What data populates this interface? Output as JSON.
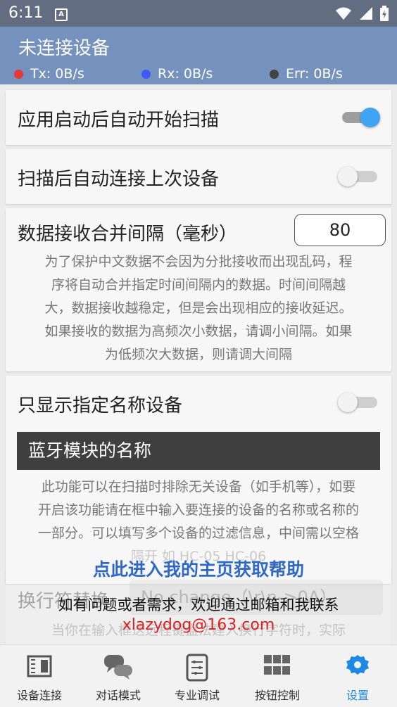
{
  "status_bar": {
    "time": "6:11",
    "notif_glyph": "A"
  },
  "header": {
    "title": "未连接设备",
    "tx": "Tx: 0B/s",
    "rx": "Rx: 0B/s",
    "err": "Err: 0B/s",
    "colors": {
      "bar": "#7591bd",
      "tx": "#e53935",
      "rx": "#3d5afe",
      "err": "#424242"
    }
  },
  "settings": {
    "auto_scan": {
      "label": "应用启动后自动开始扫描",
      "enabled": true
    },
    "auto_connect": {
      "label": "扫描后自动连接上次设备",
      "enabled": false
    },
    "merge_interval": {
      "label": "数据接收合并间隔（毫秒）",
      "value": "80",
      "desc": [
        "为了保护中文数据不会因为分批接收而出现乱码，程",
        "序将自动合并指定时间间隔内的数据。时间间隔越",
        "大，数据接收越稳定，但是会出现相应的接收延迟。",
        "如果接收的数据为高频次小数据，请调小间隔。如果",
        "为低频次大数据，则请调大间隔"
      ]
    },
    "name_filter": {
      "label": "只显示指定名称设备",
      "enabled": false,
      "placeholder": "蓝牙模块的名称",
      "desc": [
        "此功能可以在扫描时排除无关设备（如手机等），如要",
        "开启该功能请在框中输入要连接的设备的名称或名称的",
        "一部分。可以填写多个设备的过滤信息，中间需以空格",
        "隔开 如 HC-05 HC-06"
      ]
    },
    "newline": {
      "label": "换行符替换",
      "value": "No change",
      "suffix": "（\\r\\n->0A）",
      "desc": "当你在输入框迭远程键盘法建入换行字符时，实际"
    }
  },
  "overlay": {
    "link": "点此进入我的主页获取帮助",
    "contact": "如有问题或者需求，欢迎通过邮箱和我联系",
    "email": "xlazydog@163.com"
  },
  "bottom_nav": [
    {
      "label": "设备连接",
      "icon": "device-icon"
    },
    {
      "label": "对话模式",
      "icon": "chat-icon"
    },
    {
      "label": "专业调试",
      "icon": "debug-icon"
    },
    {
      "label": "按钮控制",
      "icon": "grid-icon"
    },
    {
      "label": "设置",
      "icon": "gear-icon",
      "active": true
    }
  ]
}
